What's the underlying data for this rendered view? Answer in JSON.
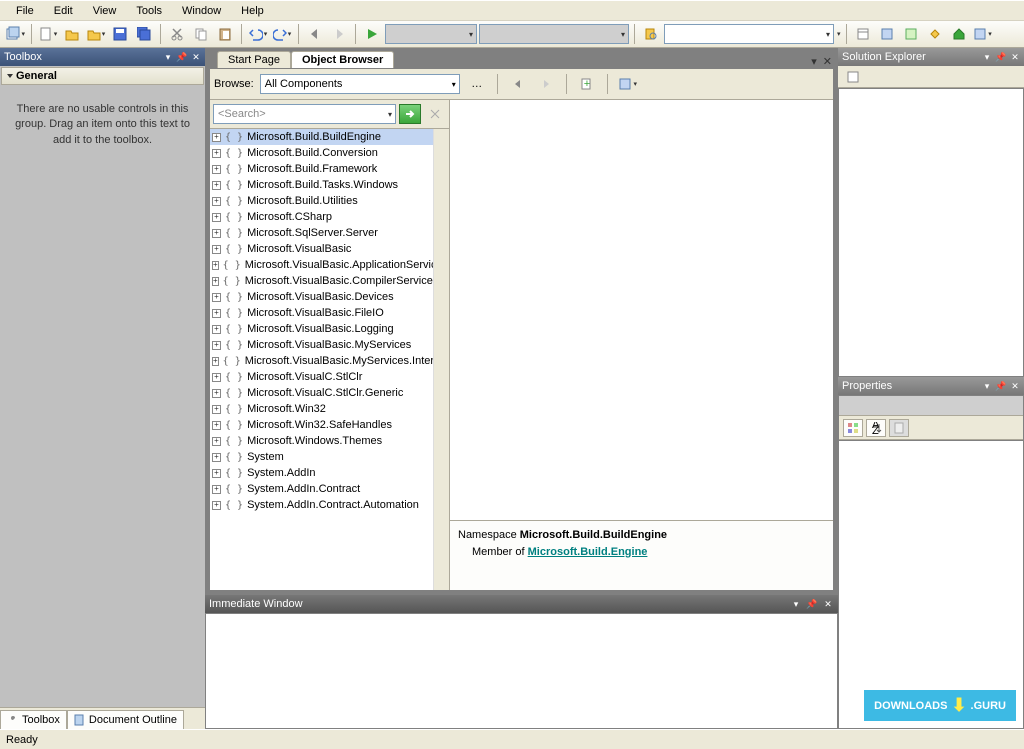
{
  "menu": {
    "items": [
      "File",
      "Edit",
      "View",
      "Tools",
      "Window",
      "Help"
    ]
  },
  "toolbox": {
    "title": "Toolbox",
    "category": "General",
    "message": "There are no usable controls in this group. Drag an item onto this text to add it to the toolbox.",
    "tabs": [
      "Toolbox",
      "Document Outline"
    ]
  },
  "docs": {
    "tabs": [
      {
        "label": "Start Page",
        "active": false
      },
      {
        "label": "Object Browser",
        "active": true
      }
    ]
  },
  "object_browser": {
    "browse_label": "Browse:",
    "browse_value": "All Components",
    "search_placeholder": "<Search>",
    "tree": [
      "Microsoft.Build.BuildEngine",
      "Microsoft.Build.Conversion",
      "Microsoft.Build.Framework",
      "Microsoft.Build.Tasks.Windows",
      "Microsoft.Build.Utilities",
      "Microsoft.CSharp",
      "Microsoft.SqlServer.Server",
      "Microsoft.VisualBasic",
      "Microsoft.VisualBasic.ApplicationServic",
      "Microsoft.VisualBasic.CompilerServices",
      "Microsoft.VisualBasic.Devices",
      "Microsoft.VisualBasic.FileIO",
      "Microsoft.VisualBasic.Logging",
      "Microsoft.VisualBasic.MyServices",
      "Microsoft.VisualBasic.MyServices.Intern",
      "Microsoft.VisualC.StlClr",
      "Microsoft.VisualC.StlClr.Generic",
      "Microsoft.Win32",
      "Microsoft.Win32.SafeHandles",
      "Microsoft.Windows.Themes",
      "System",
      "System.AddIn",
      "System.AddIn.Contract",
      "System.AddIn.Contract.Automation"
    ],
    "selected_index": 0,
    "detail": {
      "heading_prefix": "Namespace ",
      "heading_name": "Microsoft.Build.BuildEngine",
      "member_prefix": "Member of ",
      "member_link": "Microsoft.Build.Engine"
    }
  },
  "solution_explorer": {
    "title": "Solution Explorer"
  },
  "properties": {
    "title": "Properties"
  },
  "immediate": {
    "title": "Immediate Window"
  },
  "status": {
    "text": "Ready"
  },
  "watermark": {
    "brand": "DOWNLOADS",
    "suffix": ".GURU"
  }
}
